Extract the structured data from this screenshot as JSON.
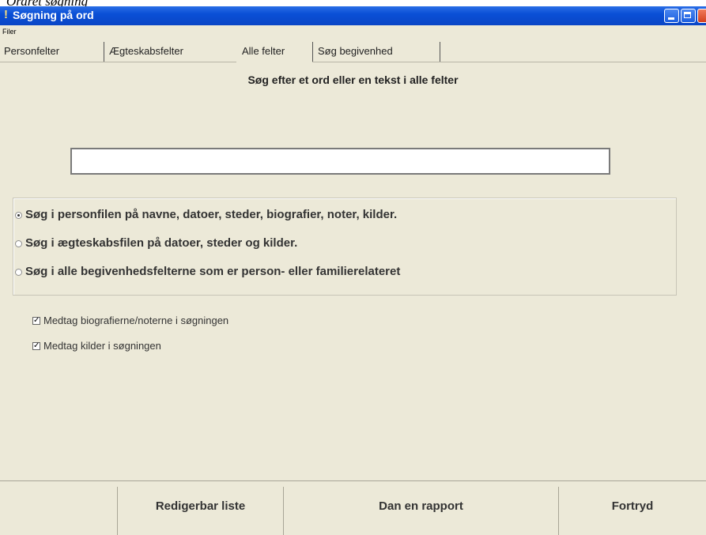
{
  "caption": "Ordret søgning",
  "window": {
    "title": "Søgning på ord",
    "controls": {
      "minimize": "minimize-icon",
      "maximize": "maximize-icon",
      "close": "close-icon"
    }
  },
  "menu": {
    "items": [
      "Filer"
    ]
  },
  "tabs": [
    {
      "label": "Personfelter",
      "active": false
    },
    {
      "label": "Ægteskabsfelter",
      "active": false
    },
    {
      "label": "Alle felter",
      "active": true
    },
    {
      "label": "Søg begivenhed",
      "active": false
    }
  ],
  "heading": "Søg efter et ord eller en tekst i alle felter",
  "search": {
    "value": "",
    "placeholder": ""
  },
  "radio_options": [
    {
      "label": "Søg i personfilen på navne, datoer, steder, biografier, noter, kilder.",
      "checked": true
    },
    {
      "label": "Søg i ægteskabsfilen på datoer, steder og kilder.",
      "checked": false
    },
    {
      "label": "Søg i alle begivenhedsfelterne som er person- eller familierelateret",
      "checked": false
    }
  ],
  "checkboxes": [
    {
      "label": "Medtag biografierne/noterne i søgningen",
      "checked": true
    },
    {
      "label": "Medtag kilder i søgningen",
      "checked": true
    }
  ],
  "buttons": {
    "edit_list": "Redigerbar liste",
    "create_report": "Dan en rapport",
    "cancel": "Fortryd"
  }
}
